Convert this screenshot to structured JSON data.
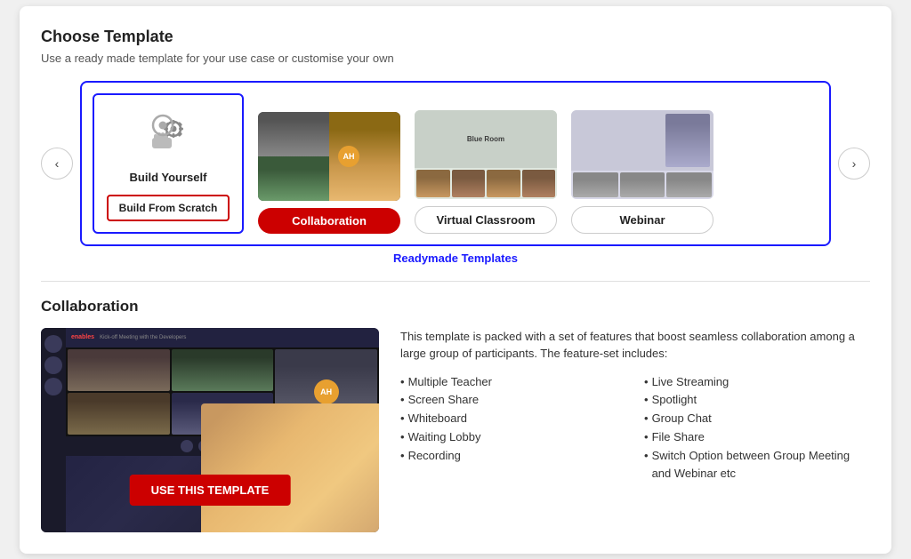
{
  "header": {
    "title": "Choose Template",
    "subtitle": "Use a ready made template for your use case or customise your own"
  },
  "carousel": {
    "prev_label": "‹",
    "next_label": "›",
    "readymade_label": "Readymade Templates",
    "build_yourself_label": "Build Yourself",
    "build_from_scratch_label": "Build From Scratch",
    "templates": [
      {
        "id": "collaboration",
        "label": "Collaboration",
        "active": true
      },
      {
        "id": "virtual-classroom",
        "label": "Virtual Classroom",
        "active": false
      },
      {
        "id": "webinar",
        "label": "Webinar",
        "active": false
      }
    ]
  },
  "detail": {
    "title": "Collaboration",
    "use_template_label": "USE THIS TEMPLATE",
    "description": "This template is packed with a set of features that boost seamless collaboration among a large group of participants. The feature-set includes:",
    "features_left": [
      "Multiple Teacher",
      "Screen Share",
      "Whiteboard",
      "Waiting Lobby",
      "Recording"
    ],
    "features_right": [
      "Live Streaming",
      "Spotlight",
      "Group Chat",
      "File Share",
      "Switch Option between Group Meeting and Webinar etc"
    ]
  }
}
